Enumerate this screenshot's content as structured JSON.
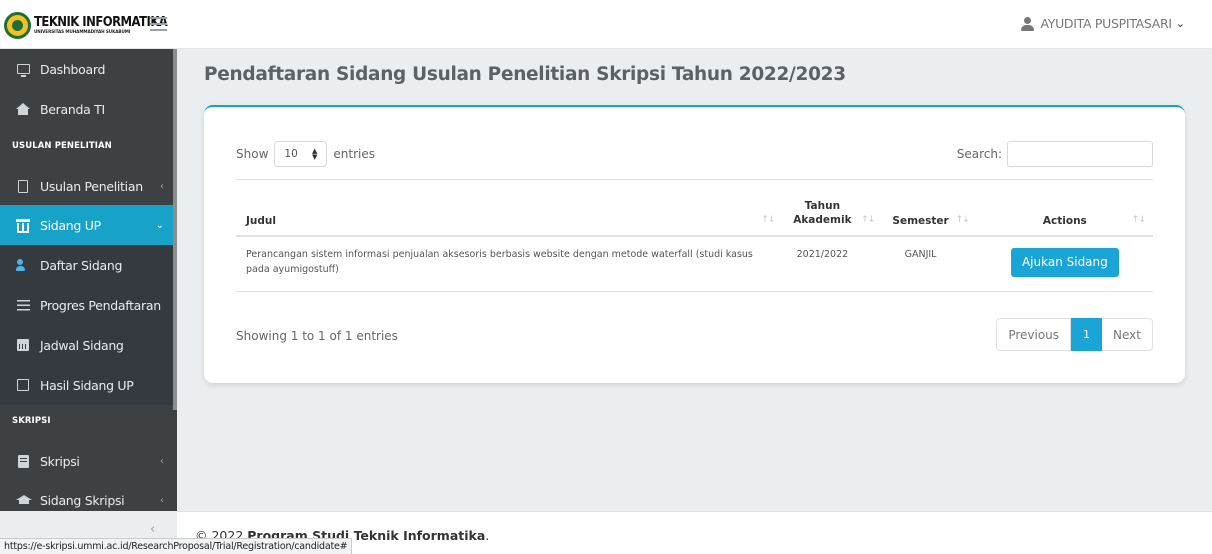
{
  "header": {
    "logo_title": "TEKNIK INFORMATIKA",
    "logo_subtitle": "UNIVERSITAS MUHAMMADIYAH SUKABUMI",
    "user_name": "AYUDITA PUSPITASARI"
  },
  "sidebar": {
    "items": [
      {
        "label": "Dashboard",
        "icon": "monitor-icon"
      },
      {
        "label": "Beranda TI",
        "icon": "home-icon"
      },
      {
        "section": "USULAN PENELITIAN"
      },
      {
        "label": "Usulan Penelitian",
        "icon": "file-icon",
        "chevron": "‹"
      },
      {
        "label": "Sidang UP",
        "icon": "institution-icon",
        "chevron": "⌄",
        "active": true
      },
      {
        "label": "Daftar Sidang",
        "icon": "user-plus-icon"
      },
      {
        "label": "Progres Pendaftaran",
        "icon": "list-icon"
      },
      {
        "label": "Jadwal Sidang",
        "icon": "calendar-icon"
      },
      {
        "label": "Hasil Sidang UP",
        "icon": "note-icon"
      },
      {
        "section": "SKRIPSI"
      },
      {
        "label": "Skripsi",
        "icon": "book-icon",
        "chevron": "‹"
      },
      {
        "label": "Sidang Skripsi",
        "icon": "graduation-cap-icon",
        "chevron": "‹"
      }
    ],
    "collapse_glyph": "‹"
  },
  "main": {
    "title": "Pendaftaran Sidang Usulan Penelitian Skripsi Tahun 2022/2023",
    "show_label": "Show",
    "page_length": "10",
    "entries_label": "entries",
    "search_label": "Search:",
    "search_value": "",
    "table": {
      "headers": [
        "Judul",
        "Tahun Akademik",
        "Semester",
        "Actions"
      ],
      "rows": [
        {
          "judul": "Perancangan sistem informasi penjualan aksesoris berbasis website dengan metode waterfall (studi kasus pada ayumigostuff)",
          "tahun_akademik": "2021/2022",
          "semester": "GANJIL",
          "action_label": "Ajukan Sidang"
        }
      ]
    },
    "info": "Showing 1 to 1 of 1 entries",
    "pagination": {
      "previous": "Previous",
      "current": "1",
      "next": "Next"
    }
  },
  "footer": {
    "prefix": "© 2022 ",
    "org": "Program Studi Teknik Informatika",
    "suffix": "."
  },
  "status_url": "https://e-skripsi.ummi.ac.id/ResearchProposal/Trial/Registration/candidate#",
  "colors": {
    "accent": "#17a2c8",
    "sidebar_bg": "#3d4144",
    "button": "#1ba5d6"
  }
}
